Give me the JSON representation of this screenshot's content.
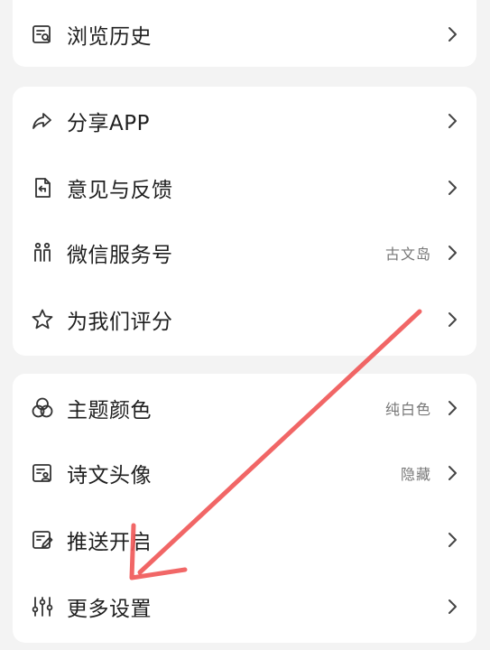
{
  "sections": [
    {
      "items": [
        {
          "label": "浏览历史",
          "value": "",
          "icon": "history-icon"
        }
      ]
    },
    {
      "items": [
        {
          "label": "分享APP",
          "value": "",
          "icon": "share-icon"
        },
        {
          "label": "意见与反馈",
          "value": "",
          "icon": "feedback-icon"
        },
        {
          "label": "微信服务号",
          "value": "古文岛",
          "icon": "wechat-service-icon"
        },
        {
          "label": "为我们评分",
          "value": "",
          "icon": "star-icon"
        }
      ]
    },
    {
      "items": [
        {
          "label": "主题颜色",
          "value": "纯白色",
          "icon": "theme-color-icon"
        },
        {
          "label": "诗文头像",
          "value": "隐藏",
          "icon": "poem-avatar-icon"
        },
        {
          "label": "推送开启",
          "value": "",
          "icon": "push-icon"
        },
        {
          "label": "更多设置",
          "value": "",
          "icon": "settings-sliders-icon"
        }
      ]
    }
  ],
  "colors": {
    "background": "#f3f3f3",
    "card": "#ffffff",
    "annotation_arrow": "#f05a5a"
  }
}
